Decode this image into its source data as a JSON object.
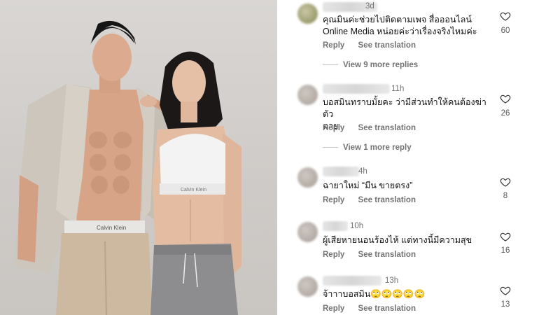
{
  "comments": [
    {
      "time": "3d",
      "text_line1": "คุณมินค่ะช่วยไปติดตามเพจ สื่อออนไลน์",
      "text_line2": "Online Media หน่อยค่ะว่าเรื่องจริงไหมค่ะ",
      "reply_label": "Reply",
      "translate_label": "See translation",
      "likes": "60",
      "view_replies": "View 9 more replies"
    },
    {
      "time": "11h",
      "text_line1": "บอสมินทราบมั้ยคะ ว่ามีส่วนทำให้คนต้องฆ่าตัว",
      "text_line2": "ตาย",
      "reply_label": "Reply",
      "translate_label": "See translation",
      "likes": "26",
      "view_replies": "View 1 more reply"
    },
    {
      "time": "4h",
      "text_line1": "ฉายาใหม่ “มีน ขายตรง”",
      "reply_label": "Reply",
      "translate_label": "See translation",
      "likes": "8"
    },
    {
      "time": "10h",
      "text_line1": "ผู้เสียหายนอนร้องไห้ แต่ทางนี้มีความสุข",
      "reply_label": "Reply",
      "translate_label": "See translation",
      "likes": "16"
    },
    {
      "time": "13h",
      "text_line1": "จ้าาาบอสมิน🙄🙄🙄🙄🙄",
      "reply_label": "Reply",
      "translate_label": "See translation",
      "likes": "13"
    }
  ],
  "photo": {
    "waistband_text_left": "Calvin Klein",
    "waistband_text_right": "Calvin Klein"
  }
}
